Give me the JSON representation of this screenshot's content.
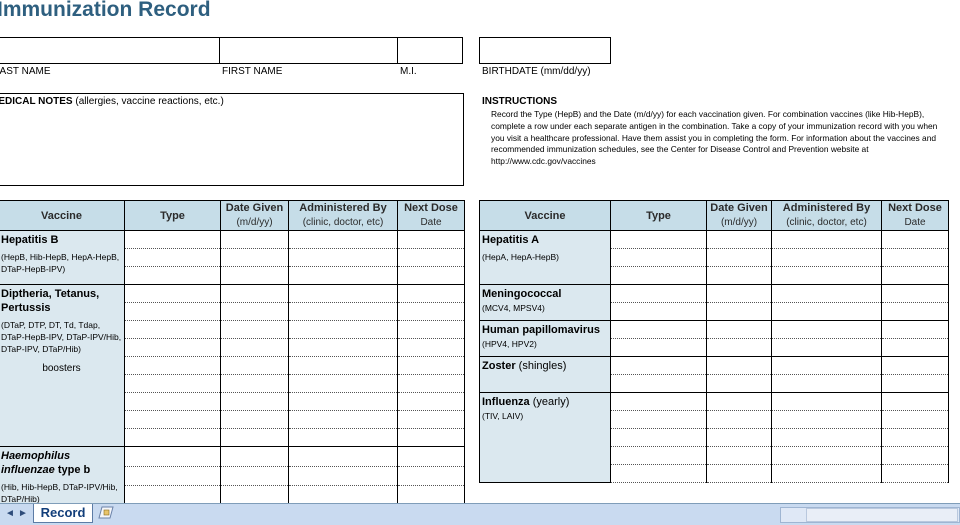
{
  "title": "Immunization Record",
  "fields": {
    "last_name": "LAST NAME",
    "first_name": "FIRST NAME",
    "mi": "M.I.",
    "birthdate": "BIRTHDATE (mm/dd/yy)"
  },
  "notes": {
    "label_bold": "MEDICAL NOTES",
    "label_rest": " (allergies, vaccine reactions, etc.)"
  },
  "instructions": {
    "title": "INSTRUCTIONS",
    "text": "Record the Type (HepB) and the Date (m/d/yy) for each vaccination given. For combination vaccines (like Hib-HepB), complete a row under each separate antigen in the combination. Take a copy of your immunization record with you when you visit a healthcare professional. Have them assist you in completing the form. For information about the vaccines and recommended immunization schedules, see the Center for Disease Control and Prevention website at http://www.cdc.gov/vaccines"
  },
  "headers": {
    "vaccine": "Vaccine",
    "type": "Type",
    "date_given": "Date Given",
    "date_given_sub": "(m/d/yy)",
    "administered_by": "Administered By",
    "administered_by_sub": "(clinic, doctor, etc)",
    "next_dose": "Next Dose",
    "next_dose_sub": "Date"
  },
  "left_vaccines": [
    {
      "name": "Hepatitis B",
      "sub": "(HepB, Hib-HepB, HepA-HepB, DTaP-HepB-IPV)"
    },
    {
      "name": "Diptheria, Tetanus, Pertussis",
      "sub": "(DTaP, DTP, DT, Td, Tdap, DTaP-HepB-IPV, DTaP-IPV/Hib, DTaP-IPV, DTaP/Hib)",
      "extra": "boosters"
    },
    {
      "name": "Haemophilus influenzae",
      "name_tail": " type b",
      "sub": "(Hib, Hib-HepB, DTaP-IPV/Hib, DTaP/Hib)"
    }
  ],
  "right_vaccines": [
    {
      "name": "Hepatitis A",
      "sub": "(HepA, HepA-HepB)"
    },
    {
      "name": "Meningococcal",
      "sub": "(MCV4, MPSV4)"
    },
    {
      "name": "Human papillomavirus",
      "sub": "(HPV4, HPV2)"
    },
    {
      "name": "Zoster",
      "name_tail": " (shingles)"
    },
    {
      "name": "Influenza",
      "name_tail": " (yearly)",
      "sub": "(TIV, LAIV)"
    }
  ],
  "sheet_tabs": {
    "active": "Record",
    "nav_first": "◄",
    "nav_last": "►",
    "new_sheet_icon": "new-sheet-icon"
  }
}
